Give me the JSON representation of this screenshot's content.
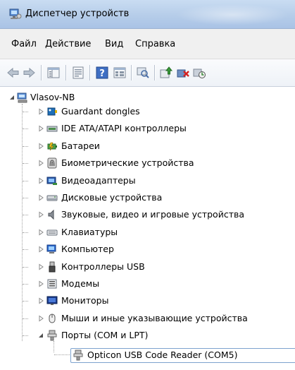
{
  "window": {
    "title": "Диспетчер устройств",
    "icon": "device-manager-icon"
  },
  "menu": [
    "Файл",
    "Действие",
    "Вид",
    "Справка"
  ],
  "toolbar": {
    "buttons": [
      "back-arrow-icon",
      "forward-arrow-icon",
      "show-hide-tree-icon",
      "properties-icon",
      "help-icon",
      "view-icon",
      "scan-hardware-icon",
      "update-driver-icon",
      "uninstall-icon",
      "disable-icon"
    ]
  },
  "tree": {
    "root": "Vlasov-NB",
    "items": [
      {
        "label": "Guardant dongles",
        "icon": "dongle-icon",
        "expanded": false
      },
      {
        "label": "IDE ATA/ATAPI контроллеры",
        "icon": "ide-controller-icon",
        "expanded": false
      },
      {
        "label": "Батареи",
        "icon": "battery-icon",
        "expanded": false
      },
      {
        "label": "Биометрические устройства",
        "icon": "fingerprint-icon",
        "expanded": false
      },
      {
        "label": "Видеоадаптеры",
        "icon": "display-adapter-icon",
        "expanded": false
      },
      {
        "label": "Дисковые устройства",
        "icon": "disk-drive-icon",
        "expanded": false
      },
      {
        "label": "Звуковые, видео и игровые устройства",
        "icon": "speaker-icon",
        "expanded": false
      },
      {
        "label": "Клавиатуры",
        "icon": "keyboard-icon",
        "expanded": false
      },
      {
        "label": "Компьютер",
        "icon": "computer-icon",
        "expanded": false
      },
      {
        "label": "Контроллеры USB",
        "icon": "usb-icon",
        "expanded": false
      },
      {
        "label": "Модемы",
        "icon": "modem-icon",
        "expanded": false
      },
      {
        "label": "Мониторы",
        "icon": "monitor-icon",
        "expanded": false
      },
      {
        "label": "Мыши и иные указывающие устройства",
        "icon": "mouse-icon",
        "expanded": false
      },
      {
        "label": "Порты (COM и LPT)",
        "icon": "port-icon",
        "expanded": true
      }
    ],
    "child": {
      "label": "Opticon USB Code Reader (COM5)",
      "icon": "port-icon"
    }
  }
}
